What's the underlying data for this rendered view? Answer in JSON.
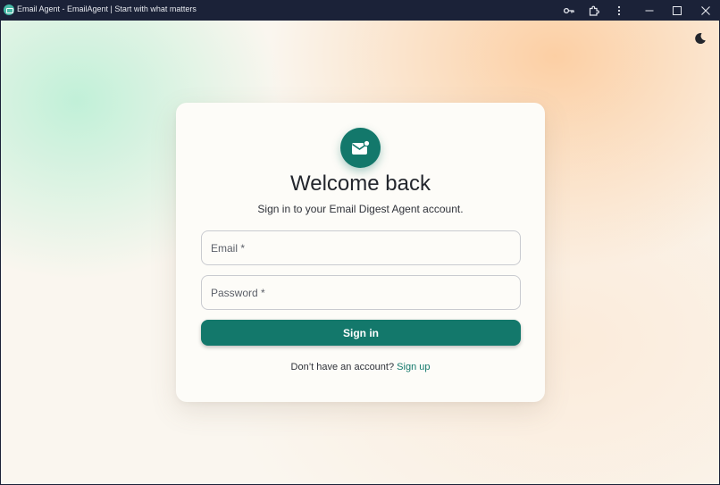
{
  "window": {
    "title": "Email Agent - EmailAgent | Start with what matters"
  },
  "icons": {
    "app": "app-logo-icon",
    "key": "key-icon",
    "extensions": "puzzle-icon",
    "menu": "more-vertical-icon",
    "minimize": "minimize-icon",
    "maximize": "maximize-icon",
    "close": "close-icon",
    "theme": "moon-icon",
    "logo": "mail-icon"
  },
  "colors": {
    "accent": "#13786b",
    "titlebar": "#1b2238"
  },
  "card": {
    "heading": "Welcome back",
    "subheading": "Sign in to your Email Digest Agent account.",
    "email_placeholder": "Email *",
    "email_value": "",
    "password_placeholder": "Password *",
    "password_value": "",
    "signin_label": "Sign in",
    "signup_prompt": "Don’t have an account?",
    "signup_link": "Sign up"
  }
}
